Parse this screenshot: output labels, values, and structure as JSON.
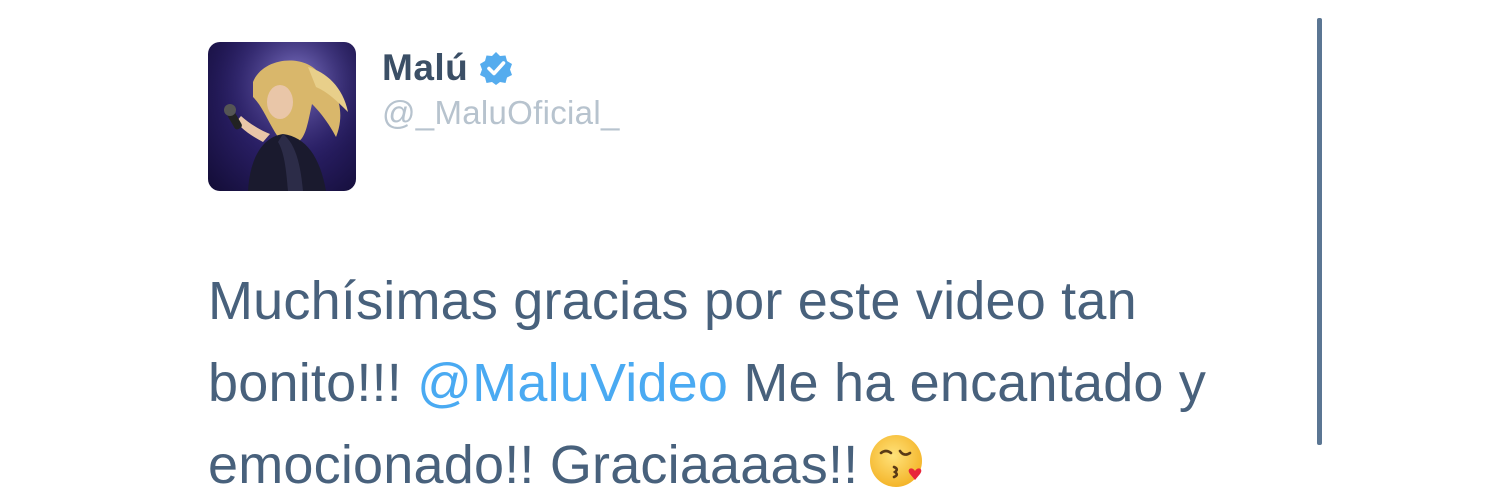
{
  "tweet": {
    "author_name": "Malú",
    "author_handle": "@_MaluOficial_",
    "verified_icon": "verified-badge-icon",
    "avatar_icon": "profile-photo",
    "text_line1": "Muchísimas gracias por este video tan",
    "text_line2_before": "bonito!!! ",
    "mention": "@MaluVideo",
    "text_line2_after": " Me ha encantado y",
    "text_line3": "emocionado!! Graciaaaas!!",
    "emoji": "face-throwing-a-kiss-icon"
  },
  "colors": {
    "name": "#3b4f66",
    "handle": "#b7c3ce",
    "body_text": "#48617c",
    "mention": "#4aaaf2",
    "verified": "#55acee",
    "divider": "#5b7693"
  }
}
